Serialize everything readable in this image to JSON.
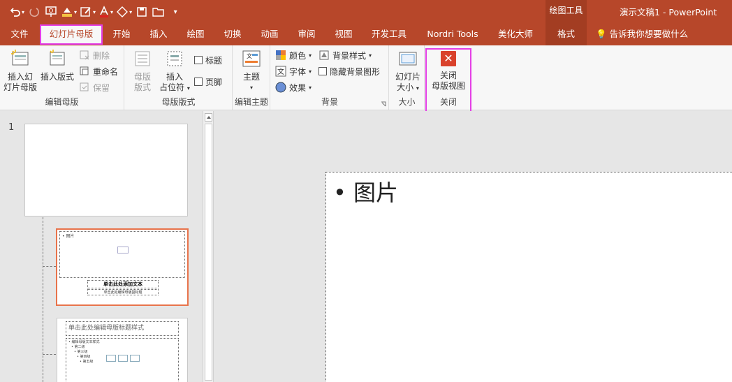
{
  "qat": {
    "items": [
      "undo-icon",
      "redo-icon",
      "present-icon",
      "format-painter-icon",
      "draw-icon",
      "font-color-icon",
      "shape-icon",
      "save-icon",
      "open-icon",
      "customize-icon"
    ]
  },
  "titlebar": {
    "context_title": "绘图工具",
    "doc_title": "演示文稿1  -  PowerPoint"
  },
  "tabs": [
    "文件",
    "幻灯片母版",
    "开始",
    "插入",
    "绘图",
    "切换",
    "动画",
    "审阅",
    "视图",
    "开发工具",
    "Nordri Tools",
    "美化大师",
    "格式"
  ],
  "tellme": "告诉我你想要做什么",
  "ribbon": {
    "edit_master": {
      "insert_master": [
        "插入幻",
        "灯片母版"
      ],
      "insert_layout": "插入版式",
      "delete": "删除",
      "rename": "重命名",
      "preserve": "保留",
      "label": "编辑母版"
    },
    "master_layout": {
      "master_layout_btn": [
        "母版",
        "版式"
      ],
      "insert_placeholder": [
        "插入",
        "占位符"
      ],
      "title": "标题",
      "footer": "页脚",
      "label": "母版版式"
    },
    "edit_theme": {
      "theme": "主题",
      "label": "编辑主题"
    },
    "background": {
      "colors": "颜色",
      "fonts": "字体",
      "effects": "效果",
      "bg_styles": "背景样式",
      "hide_bg": "隐藏背景图形",
      "label": "背景"
    },
    "size": {
      "slide_size": [
        "幻灯片",
        "大小"
      ],
      "label": "大小"
    },
    "close": {
      "close_btn": [
        "关闭",
        "母版视图"
      ],
      "label": "关闭",
      "icon_glyph": "✕"
    }
  },
  "thumbs": {
    "number": "1",
    "layout1": {
      "pic_label": "• 图片",
      "title": "单击此处添加文本",
      "subtitle": "单击此处编辑母版副标题"
    },
    "layout2": {
      "title": "单击此处编辑母版标题样式",
      "body": [
        "• 编辑母版文本样式",
        "• 第二级",
        "• 第三级",
        "• 第四级",
        "• 第五级"
      ]
    }
  },
  "slide": {
    "bullet": "• 图片"
  },
  "colors": {
    "accent": "#b7472a",
    "highlight": "#e43ee6",
    "selected_thumb": "#e8734b"
  }
}
